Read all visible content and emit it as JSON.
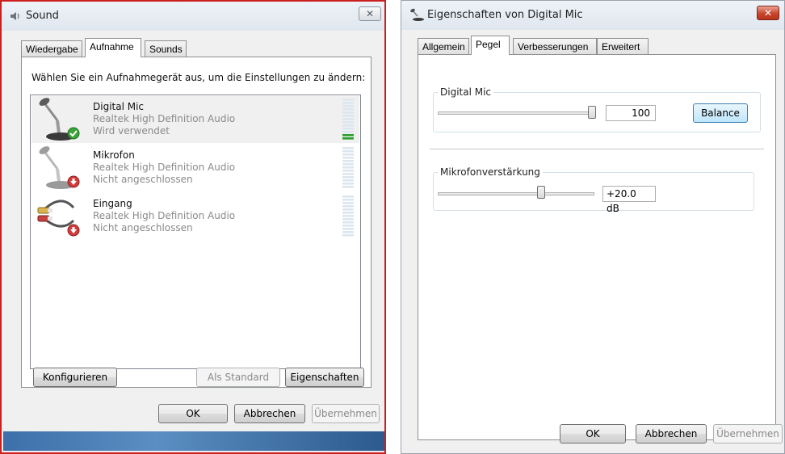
{
  "left_window": {
    "title": "Sound",
    "close_label": "✕",
    "tabs": [
      {
        "label": "Wiedergabe"
      },
      {
        "label": "Aufnahme"
      },
      {
        "label": "Sounds"
      }
    ],
    "instruction": "Wählen Sie ein Aufnahmegerät aus, um die Einstellungen zu ändern:",
    "devices": [
      {
        "name": "Digital Mic",
        "driver": "Realtek High Definition Audio",
        "status": "Wird verwendet",
        "icon": "microphone-icon",
        "badge": "check-icon",
        "level": 0.15
      },
      {
        "name": "Mikrofon",
        "driver": "Realtek High Definition Audio",
        "status": "Nicht angeschlossen",
        "icon": "microphone-icon",
        "badge": "unplugged-icon",
        "level": 0
      },
      {
        "name": "Eingang",
        "driver": "Realtek High Definition Audio",
        "status": "Nicht angeschlossen",
        "icon": "audio-cable-icon",
        "badge": "unplugged-icon",
        "level": 0
      }
    ],
    "buttons": {
      "configure": "Konfigurieren",
      "set_default": "Als Standard",
      "properties": "Eigenschaften",
      "ok": "OK",
      "cancel": "Abbrechen",
      "apply": "Übernehmen"
    }
  },
  "right_window": {
    "title": "Eigenschaften von Digital Mic",
    "close_label": "✕",
    "tabs": [
      {
        "label": "Allgemein"
      },
      {
        "label": "Pegel"
      },
      {
        "label": "Verbesserungen"
      },
      {
        "label": "Erweitert"
      }
    ],
    "digital_mic": {
      "label": "Digital Mic",
      "value": "100",
      "level": 1.0,
      "balance_button": "Balance"
    },
    "boost": {
      "label": "Mikrofonverstärkung",
      "value": "+20.0 dB",
      "level": 0.67
    },
    "buttons": {
      "ok": "OK",
      "cancel": "Abbrechen",
      "apply": "Übernehmen"
    }
  },
  "colors": {
    "highlight_border": "#cc1f1f",
    "level_active": "#2a9d2a",
    "level_idle": "#dce6ef"
  }
}
